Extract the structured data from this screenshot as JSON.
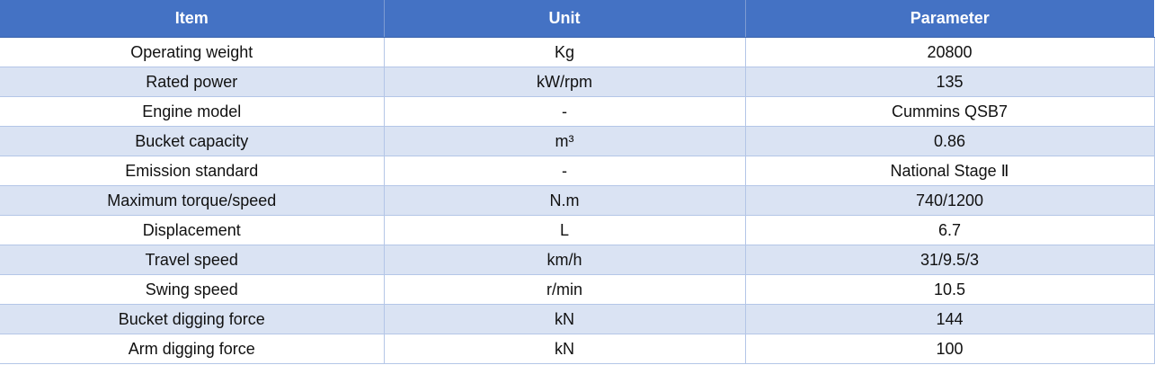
{
  "table": {
    "headers": [
      "Item",
      "Unit",
      "Parameter"
    ],
    "rows": [
      [
        "Operating weight",
        "Kg",
        "20800"
      ],
      [
        "Rated power",
        "kW/rpm",
        "135"
      ],
      [
        "Engine model",
        "-",
        "Cummins QSB7"
      ],
      [
        "Bucket capacity",
        "m³",
        "0.86"
      ],
      [
        "Emission standard",
        "-",
        "National Stage Ⅱ"
      ],
      [
        "Maximum torque/speed",
        "N.m",
        "740/1200"
      ],
      [
        "Displacement",
        "L",
        "6.7"
      ],
      [
        "Travel speed",
        "km/h",
        "31/9.5/3"
      ],
      [
        "Swing speed",
        "r/min",
        "10.5"
      ],
      [
        "Bucket digging force",
        "kN",
        "144"
      ],
      [
        "Arm digging force",
        "kN",
        "100"
      ]
    ]
  },
  "colors": {
    "header_bg": "#4472c4",
    "header_text": "#ffffff",
    "row_alt_bg": "#dae3f3",
    "grid_line": "#b4c6e7"
  }
}
